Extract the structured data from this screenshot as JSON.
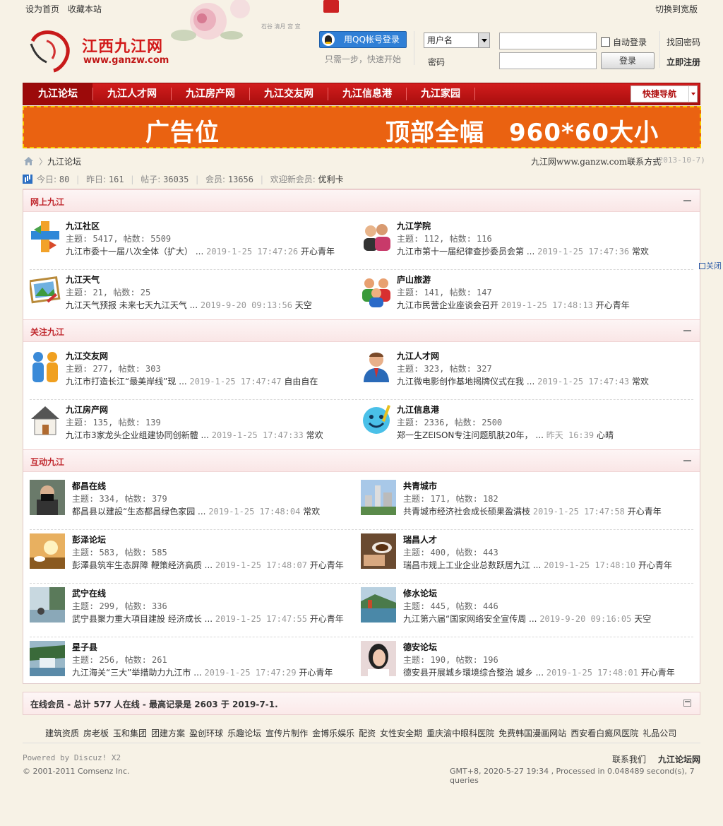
{
  "topbar": {
    "set_home": "设为首页",
    "bookmark": "收藏本站",
    "wide": "切换到宽版"
  },
  "logo": {
    "title": "江西九江网",
    "url": "www.ganzw.com"
  },
  "login": {
    "qq_button": "用QQ帐号登录",
    "qq_sub": "只需一步，快速开始",
    "username_select": "用户名",
    "password_label": "密码",
    "auto_login": "自动登录",
    "login_button": "登录",
    "find_password": "找回密码",
    "register": "立即注册"
  },
  "nav": {
    "items": [
      "九江论坛",
      "九江人才网",
      "九江房产网",
      "九江交友网",
      "九江信息港",
      "九江家园"
    ],
    "quick_nav": "快捷导航"
  },
  "banner": {
    "left": "广告位",
    "right": "顶部全幅　960*60大小"
  },
  "breadcrumb": {
    "current": "九江论坛",
    "contact": "九江网www.ganzw.com联系方式",
    "date": "(2013-10-7)"
  },
  "stats": {
    "today_label": "今日:",
    "today": "80",
    "yesterday_label": "昨日:",
    "yesterday": "161",
    "posts_label": "帖子:",
    "posts": "36035",
    "members_label": "会员:",
    "members": "13656",
    "welcome_label": "欢迎新会员:",
    "welcome": "优利卡"
  },
  "close_float": "关闭",
  "categories": [
    {
      "title": "网上九江",
      "forums": [
        {
          "name": "九江社区",
          "stats": "主题: 5417, 帖数: 5509",
          "last": "九江市委十一届八次全体（扩大） ...",
          "time": "2019-1-25 17:47:26",
          "user": "开心青年",
          "icon": "cross-arrows-icon"
        },
        {
          "name": "九江学院",
          "stats": "主题: 112, 帖数: 116",
          "last": "九江市第十一届纪律查抄委员会第 ...",
          "time": "2019-1-25 17:47:36",
          "user": "常欢",
          "icon": "users-icon"
        },
        {
          "name": "九江天气",
          "stats": "主题: 21, 帖数: 25",
          "last": "九江天气预报 未来七天九江天气 ...",
          "time": "2019-9-20 09:13:56",
          "user": "天空",
          "icon": "landscape-picture-icon"
        },
        {
          "name": "庐山旅游",
          "stats": "主题: 141, 帖数: 147",
          "last": "九江市民营企业座谈会召开",
          "time": "2019-1-25 17:48:13",
          "user": "开心青年",
          "icon": "group-icon"
        }
      ]
    },
    {
      "title": "关注九江",
      "forums": [
        {
          "name": "九江交友网",
          "stats": "主题: 277, 帖数: 303",
          "last": "九江市打造长江“最美岸线”现 ...",
          "time": "2019-1-25 17:47:47",
          "user": "自由自在",
          "icon": "couple-icon"
        },
        {
          "name": "九江人才网",
          "stats": "主题: 323, 帖数: 327",
          "last": "九江微电影创作基地揭牌仪式在我 ...",
          "time": "2019-1-25 17:47:43",
          "user": "常欢",
          "icon": "businessman-icon"
        },
        {
          "name": "九江房产网",
          "stats": "主题: 135, 帖数: 139",
          "last": "九江市3家龙头企业组建协同创新體 ...",
          "time": "2019-1-25 17:47:33",
          "user": "常欢",
          "icon": "house-icon"
        },
        {
          "name": "九江信息港",
          "stats": "主题: 2336, 帖数: 2500",
          "last": "郑一生ZEISON专注问题肌肤20年， ...",
          "time": "昨天 16:39",
          "user": "心晴",
          "icon": "smiley-icon"
        }
      ]
    },
    {
      "title": "互动九江",
      "forums": [
        {
          "name": "都昌在线",
          "stats": "主题: 334, 帖数: 379",
          "last": "都昌县以建設“生态都昌绿色家园 ...",
          "time": "2019-1-25 17:48:04",
          "user": "常欢",
          "icon": "photographer-photo-icon"
        },
        {
          "name": "共青城市",
          "stats": "主题: 171, 帖数: 182",
          "last": "共青城市经济社会成长硕果盈满枝",
          "time": "2019-1-25 17:47:58",
          "user": "开心青年",
          "icon": "city-photo-icon"
        },
        {
          "name": "彭泽论坛",
          "stats": "主题: 583, 帖数: 585",
          "last": "彭澤县筑牢生态屏障 鞭策经济高质 ...",
          "time": "2019-1-25 17:48:07",
          "user": "开心青年",
          "icon": "sunset-photo-icon"
        },
        {
          "name": "瑞昌人才",
          "stats": "主题: 400, 帖数: 443",
          "last": "瑞昌市规上工业企业总数跃居九江 ...",
          "time": "2019-1-25 17:48:10",
          "user": "开心青年",
          "icon": "coffee-photo-icon"
        },
        {
          "name": "武宁在线",
          "stats": "主题: 299, 帖数: 336",
          "last": "武宁县聚力重大項目建設 经济成长 ...",
          "time": "2019-1-25 17:47:55",
          "user": "开心青年",
          "icon": "lake-photo-icon"
        },
        {
          "name": "修水论坛",
          "stats": "主题: 445, 帖数: 446",
          "last": "九江第六届“国家网络安全宣传周 ...",
          "time": "2019-9-20 09:16:05",
          "user": "天空",
          "icon": "river-photo-icon"
        },
        {
          "name": "星子县",
          "stats": "主题: 256, 帖数: 261",
          "last": "九江海关“三大”举措助力九江市 ...",
          "time": "2019-1-25 17:47:29",
          "user": "开心青年",
          "icon": "waterfall-photo-icon"
        },
        {
          "name": "德安论坛",
          "stats": "主题: 190, 帖数: 196",
          "last": "德安县开展城乡環境综合整治 城乡 ...",
          "time": "2019-1-25 17:48:01",
          "user": "开心青年",
          "icon": "girl-photo-icon"
        }
      ]
    }
  ],
  "online": {
    "text": "在线会员 - 总计 577 人在线 - 最高记录是 2603 于 2019-7-1."
  },
  "links": [
    "建筑资质",
    "房老板",
    "玉和集团",
    "团建方案",
    "盈创环球",
    "乐趣论坛",
    "宣传片制作",
    "金博乐娱乐",
    "配资",
    "女性安全期",
    "重庆渝中眼科医院",
    "免费韩国漫画网站",
    "西安看白癜风医院",
    "礼品公司"
  ],
  "footer": {
    "powered": "Powered by Discuz! X2",
    "copyright": "© 2001-2011 Comsenz Inc.",
    "contact": "联系我们",
    "site": "九江论坛网",
    "gmt": "GMT+8, 2020-5-27 19:34 , Processed in 0.048489 second(s), 7 queries"
  }
}
